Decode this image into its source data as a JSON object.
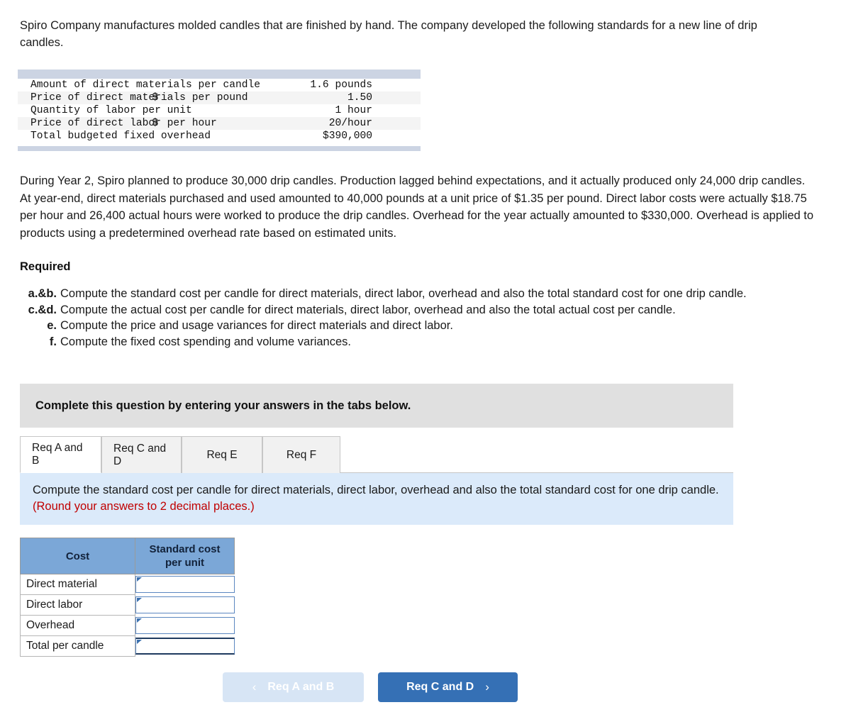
{
  "intro": "Spiro Company manufactures molded candles that are finished by hand. The company developed the following standards for a new line of drip candles.",
  "standards_table": {
    "rows": [
      {
        "label": "Amount of direct materials per candle",
        "currency": "",
        "value": "1.6 pounds"
      },
      {
        "label": "Price of direct materials per pound",
        "currency": "$",
        "value": "1.50"
      },
      {
        "label": "Quantity of labor per unit",
        "currency": "",
        "value": "1 hour"
      },
      {
        "label": "Price of direct labor per hour",
        "currency": "$",
        "value": "20/hour"
      },
      {
        "label": "Total budgeted fixed overhead",
        "currency": "",
        "value": "$390,000"
      }
    ]
  },
  "paragraph2": "During Year 2, Spiro planned to produce 30,000 drip candles. Production lagged behind expectations, and it actually produced only 24,000 drip candles. At year-end, direct materials purchased and used amounted to 40,000 pounds at a unit price of $1.35 per pound. Direct labor costs were actually $18.75 per hour and 26,400 actual hours were worked to produce the drip candles. Overhead for the year actually amounted to $330,000. Overhead is applied to products using a predetermined overhead rate based on estimated units.",
  "required": {
    "heading": "Required",
    "items": [
      {
        "marker": "a.&b.",
        "text": "Compute the standard cost per candle for direct materials, direct labor, overhead and also the total standard cost for one drip candle."
      },
      {
        "marker": "c.&d.",
        "text": "Compute the actual cost per candle for direct materials, direct labor, overhead and also the total actual cost per candle."
      },
      {
        "marker": "e.",
        "text": "Compute the price and usage variances for direct materials and direct labor."
      },
      {
        "marker": "f.",
        "text": "Compute the fixed cost spending and volume variances."
      }
    ]
  },
  "banner": {
    "text": "Complete this question by entering your answers in the tabs below."
  },
  "tabs": [
    {
      "label": "Req A and B",
      "active": true
    },
    {
      "label": "Req C and D",
      "active": false
    },
    {
      "label": "Req E",
      "active": false
    },
    {
      "label": "Req F",
      "active": false
    }
  ],
  "instruction_panel": {
    "main": "Compute the standard cost per candle for direct materials, direct labor, overhead and also the total standard cost for one drip candle. ",
    "note": "(Round your answers to 2 decimal places.)"
  },
  "answer_table": {
    "headers": [
      "Cost",
      "Standard cost per unit"
    ],
    "header_cost": "Cost",
    "header_std_line1": "Standard cost",
    "header_std_line2": "per unit",
    "rows": [
      {
        "label": "Direct material",
        "value": ""
      },
      {
        "label": "Direct labor",
        "value": ""
      },
      {
        "label": "Overhead",
        "value": ""
      },
      {
        "label": "Total per candle",
        "value": ""
      }
    ]
  },
  "nav": {
    "prev_label": "Req A and B",
    "prev_chevron": "‹",
    "next_label": "Req C and D",
    "next_chevron": "›"
  },
  "colors": {
    "header_blue": "#7ba7d7",
    "panel_blue": "#dbeafa",
    "banner_grey": "#e0e0e0",
    "button_blue": "#3570b5",
    "button_disabled": "#d7e5f5",
    "note_red": "#c00000",
    "table_band": "#ccd4e3"
  }
}
